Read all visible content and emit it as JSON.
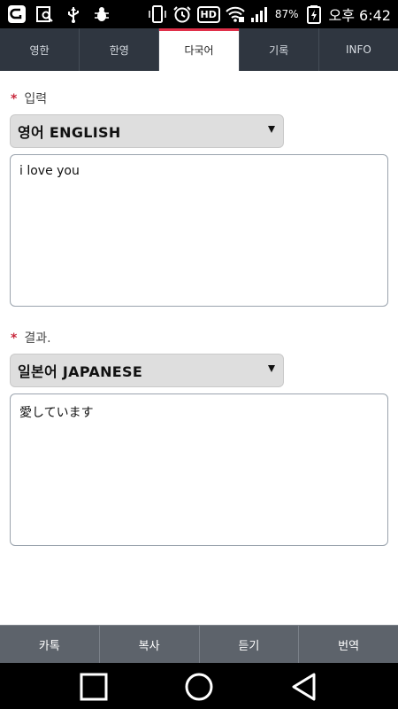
{
  "status_bar": {
    "battery_percent": "87%",
    "time": "오후 6:42",
    "hd_label": "HD",
    "icons": [
      "carrier-logo-icon",
      "image-search-icon",
      "usb-icon",
      "bug-icon",
      "vibrate-icon",
      "alarm-icon",
      "hd-icon",
      "wifi-icon",
      "signal-icon",
      "battery-charging-icon"
    ]
  },
  "tabs": [
    {
      "label": "영한",
      "active": false
    },
    {
      "label": "한영",
      "active": false
    },
    {
      "label": "다국어",
      "active": true
    },
    {
      "label": "기록",
      "active": false
    },
    {
      "label": "INFO",
      "active": false
    }
  ],
  "input": {
    "star": "*",
    "label": "입력",
    "language": "영어 ENGLISH",
    "text": "i love you"
  },
  "result": {
    "star": "*",
    "label": "결과.",
    "language": "일본어 JAPANESE",
    "text": "愛しています"
  },
  "actions": [
    {
      "label": "카톡"
    },
    {
      "label": "복사"
    },
    {
      "label": "듣기"
    },
    {
      "label": "번역"
    }
  ],
  "nav": [
    "recents-icon",
    "home-icon",
    "back-icon"
  ],
  "colors": {
    "tab_bar": "#2f3640",
    "active_tab_accent": "#e0304a",
    "required_star": "#c8283c",
    "action_bar": "#5d636b"
  }
}
